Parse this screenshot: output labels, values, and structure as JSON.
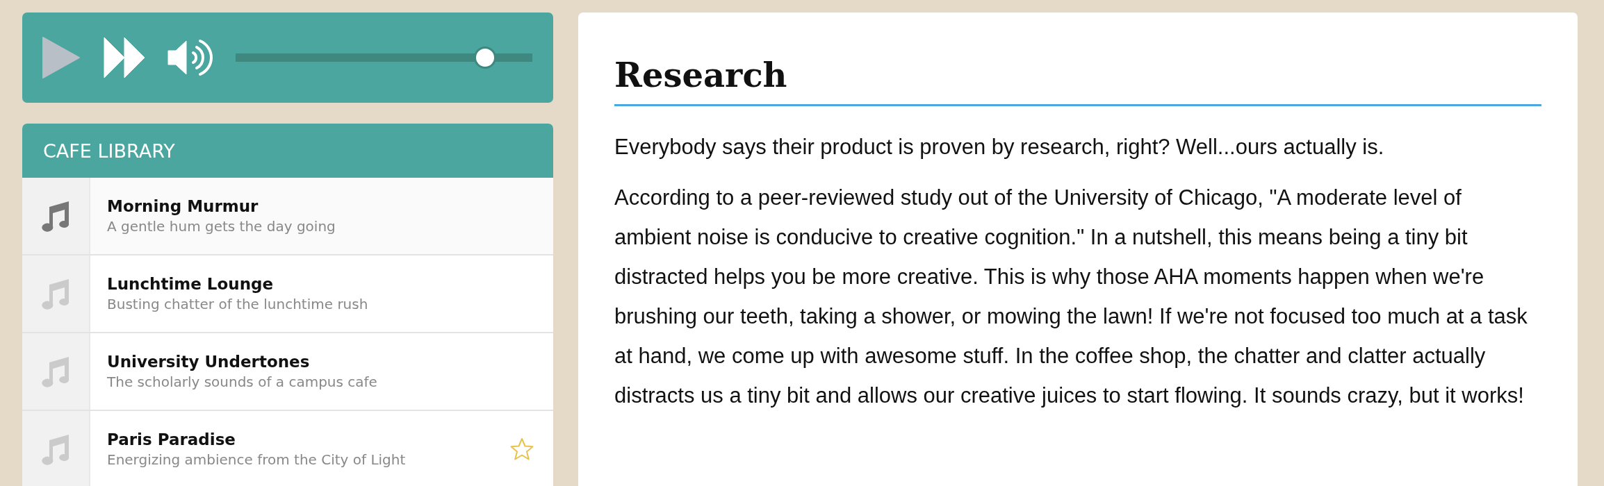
{
  "player": {
    "play": {
      "disabled": true
    },
    "volume": {
      "level": 0.84
    }
  },
  "library": {
    "title": "CAFE LIBRARY",
    "tracks": [
      {
        "title": "Morning Murmur",
        "description": "A gentle hum gets the day going",
        "selected": true,
        "star": false
      },
      {
        "title": "Lunchtime Lounge",
        "description": "Busting chatter of the lunchtime rush",
        "selected": false,
        "star": false
      },
      {
        "title": "University Undertones",
        "description": "The scholarly sounds of a campus cafe",
        "selected": false,
        "star": false
      },
      {
        "title": "Paris Paradise",
        "description": "Energizing ambience from the City of Light",
        "selected": false,
        "star": true
      }
    ]
  },
  "article": {
    "heading": "Research",
    "paragraphs": [
      "Everybody says their product is proven by research, right? Well...ours actually is.",
      "According to a peer-reviewed study out of the University of Chicago, \"A moderate level of ambient noise is conducive to creative cognition.\" In a nutshell, this means being a tiny bit distracted helps you be more creative. This is why those AHA moments happen when we're brushing our teeth, taking a shower, or mowing the lawn! If we're not focused too much at a task at hand, we come up with awesome stuff. In the coffee shop, the chatter and clatter actually distracts us a tiny bit and allows our creative juices to start flowing. It sounds crazy, but it works!"
    ]
  }
}
